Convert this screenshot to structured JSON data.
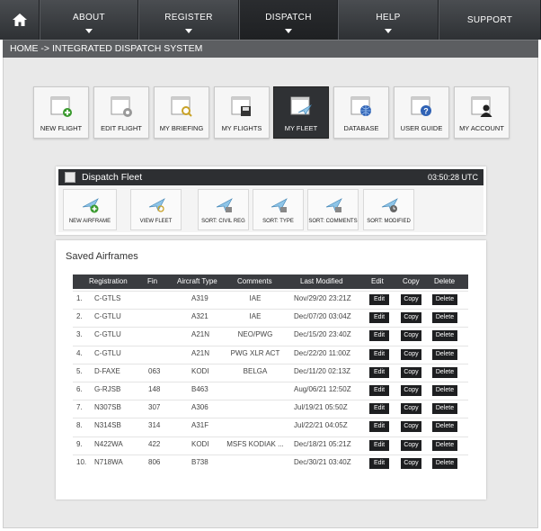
{
  "nav": {
    "items": [
      {
        "label": "ABOUT",
        "has_arrow": true
      },
      {
        "label": "REGISTER",
        "has_arrow": true
      },
      {
        "label": "DISPATCH",
        "has_arrow": true,
        "active": true
      },
      {
        "label": "HELP",
        "has_arrow": true
      },
      {
        "label": "SUPPORT",
        "has_arrow": false
      }
    ]
  },
  "breadcrumb": "HOME -> INTEGRATED DISPATCH SYSTEM",
  "tiles": [
    {
      "label": "NEW FLIGHT",
      "icon": "new-flight-icon"
    },
    {
      "label": "EDIT FLIGHT",
      "icon": "edit-flight-icon"
    },
    {
      "label": "MY BRIEFING",
      "icon": "briefing-icon"
    },
    {
      "label": "MY FLIGHTS",
      "icon": "save-disk-icon"
    },
    {
      "label": "MY FLEET",
      "icon": "fleet-plane-icon",
      "active": true
    },
    {
      "label": "DATABASE",
      "icon": "globe-icon"
    },
    {
      "label": "USER GUIDE",
      "icon": "help-icon"
    },
    {
      "label": "MY ACCOUNT",
      "icon": "user-icon"
    }
  ],
  "panel": {
    "title": "Dispatch Fleet",
    "clock": "03:50:28 UTC",
    "buttons": [
      {
        "label": "NEW AIRFRAME",
        "icon": "new-airframe-icon"
      },
      {
        "label": "VIEW FLEET",
        "icon": "view-fleet-icon"
      },
      {
        "label": "SORT: CIVIL REG",
        "icon": "sort-reg-icon"
      },
      {
        "label": "SORT: TYPE",
        "icon": "sort-type-icon"
      },
      {
        "label": "SORT: COMMENTS",
        "icon": "sort-comments-icon"
      },
      {
        "label": "SORT: MODIFIED",
        "icon": "sort-modified-icon"
      }
    ]
  },
  "saved": {
    "title": "Saved Airframes",
    "columns": [
      "Registration",
      "Fin",
      "Aircraft Type",
      "Comments",
      "Last Modified",
      "Edit",
      "Copy",
      "Delete"
    ],
    "edit_label": "Edit",
    "copy_label": "Copy",
    "delete_label": "Delete",
    "rows": [
      {
        "n": "1.",
        "reg": "C-GTLS",
        "fin": "",
        "type": "A319",
        "comments": "IAE",
        "modified": "Nov/29/20 23:21Z"
      },
      {
        "n": "2.",
        "reg": "C-GTLU",
        "fin": "",
        "type": "A321",
        "comments": "IAE",
        "modified": "Dec/07/20 03:04Z"
      },
      {
        "n": "3.",
        "reg": "C-GTLU",
        "fin": "",
        "type": "A21N",
        "comments": "NEO/PWG",
        "modified": "Dec/15/20 23:40Z"
      },
      {
        "n": "4.",
        "reg": "C-GTLU",
        "fin": "",
        "type": "A21N",
        "comments": "PWG XLR ACT",
        "modified": "Dec/22/20 11:00Z"
      },
      {
        "n": "5.",
        "reg": "D-FAXE",
        "fin": "063",
        "type": "KODI",
        "comments": "BELGA",
        "modified": "Dec/11/20 02:13Z"
      },
      {
        "n": "6.",
        "reg": "G-RJSB",
        "fin": "148",
        "type": "B463",
        "comments": "",
        "modified": "Aug/06/21 12:50Z"
      },
      {
        "n": "7.",
        "reg": "N307SB",
        "fin": "307",
        "type": "A306",
        "comments": "",
        "modified": "Jul/19/21 05:50Z"
      },
      {
        "n": "8.",
        "reg": "N314SB",
        "fin": "314",
        "type": "A31F",
        "comments": "",
        "modified": "Jul/22/21 04:05Z"
      },
      {
        "n": "9.",
        "reg": "N422WA",
        "fin": "422",
        "type": "KODI",
        "comments": "MSFS KODIAK ...",
        "modified": "Dec/18/21 05:21Z"
      },
      {
        "n": "10.",
        "reg": "N718WA",
        "fin": "806",
        "type": "B738",
        "comments": "",
        "modified": "Dec/30/21 03:40Z"
      }
    ]
  }
}
